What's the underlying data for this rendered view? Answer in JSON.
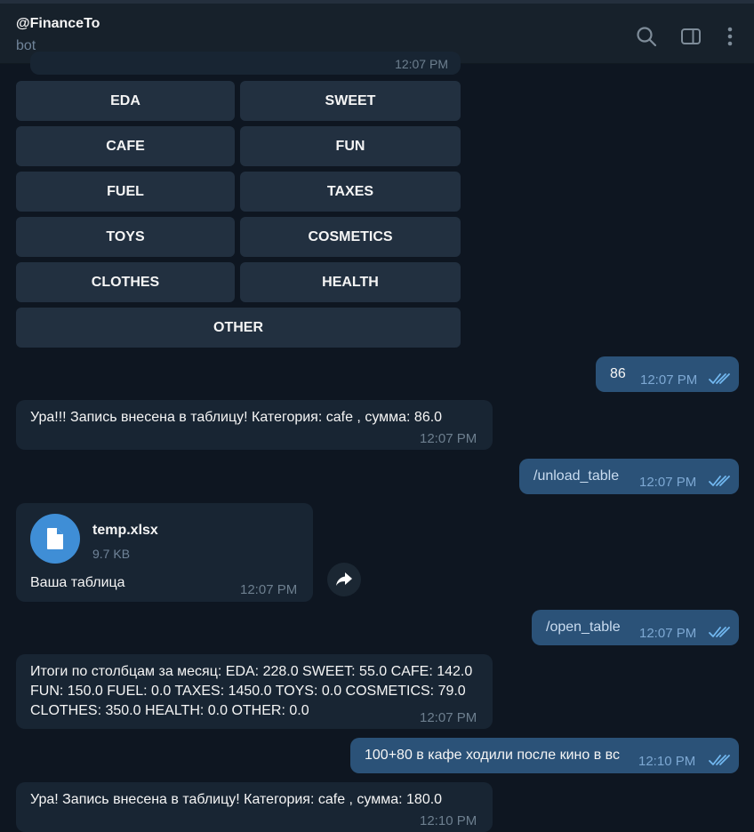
{
  "header": {
    "title": "@FinanceTo",
    "subtitle": "bot"
  },
  "partial_message": {
    "time": "12:07 PM"
  },
  "keyboard": {
    "buttons": [
      "EDA",
      "SWEET",
      "CAFE",
      "FUN",
      "FUEL",
      "TAXES",
      "TOYS",
      "COSMETICS",
      "CLOTHES",
      "HEALTH",
      "OTHER"
    ]
  },
  "messages": {
    "m1": {
      "text": "86",
      "time": "12:07 PM"
    },
    "m2": {
      "text": "Ура!!! Запись внесена в таблицу! Категория: cafe , сумма: 86.0",
      "time": "12:07 PM"
    },
    "m3": {
      "text": "/unload_table",
      "time": "12:07 PM"
    },
    "m4": {
      "file_name": "temp.xlsx",
      "file_size": "9.7 KB",
      "caption": "Ваша таблица",
      "time": "12:07 PM"
    },
    "m5": {
      "text": "/open_table",
      "time": "12:07 PM"
    },
    "m6": {
      "line1": "Итоги по столбцам за месяц: EDA: 228.0  SWEET: 55.0  CAFE: 142.0",
      "line2": "FUN: 150.0  FUEL: 0.0  TAXES: 1450.0  TOYS: 0.0  COSMETICS: 79.0",
      "line3": "CLOTHES: 350.0  HEALTH: 0.0  OTHER: 0.0",
      "time": "12:07 PM"
    },
    "m7": {
      "text": "100+80 в кафе ходили после кино в вс",
      "time": "12:10 PM"
    },
    "m8": {
      "text": "Ура! Запись внесена в таблицу! Категория: cafe , сумма: 180.0",
      "time": "12:10 PM"
    }
  },
  "icons": {
    "search": "search-icon",
    "sidebar": "sidebar-toggle-icon",
    "menu": "more-vertical-icon",
    "file": "document-icon",
    "forward": "forward-icon",
    "read": "double-check-icon"
  },
  "colors": {
    "background": "#0e1621",
    "header": "#17212b",
    "incoming_bubble": "#182533",
    "outgoing_bubble": "#2b5278",
    "keyboard_button": "#223040",
    "accent": "#3f8ed6",
    "read_check": "#72b8f0"
  }
}
